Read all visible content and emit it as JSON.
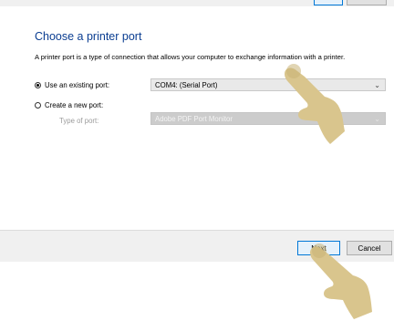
{
  "top_buttons": {
    "primary_label": "",
    "secondary_label": ""
  },
  "wizard": {
    "title": "Choose a printer port",
    "description": "A printer port is a type of connection that allows your computer to exchange information with a printer.",
    "existing_port": {
      "label": "Use an existing port:",
      "checked": true,
      "selected_value": "COM4: (Serial Port)"
    },
    "new_port": {
      "label": "Create a new port:",
      "checked": false,
      "type_label": "Type of port:",
      "selected_value": "Adobe PDF Port Monitor"
    }
  },
  "footer": {
    "next_label": "Next",
    "cancel_label": "Cancel"
  },
  "colors": {
    "title": "#0a3d91",
    "accent": "#0078d7",
    "pointer_hand": "#d9c58d"
  },
  "icons": [
    "chevron-down-icon",
    "pointing-hand-icon"
  ]
}
